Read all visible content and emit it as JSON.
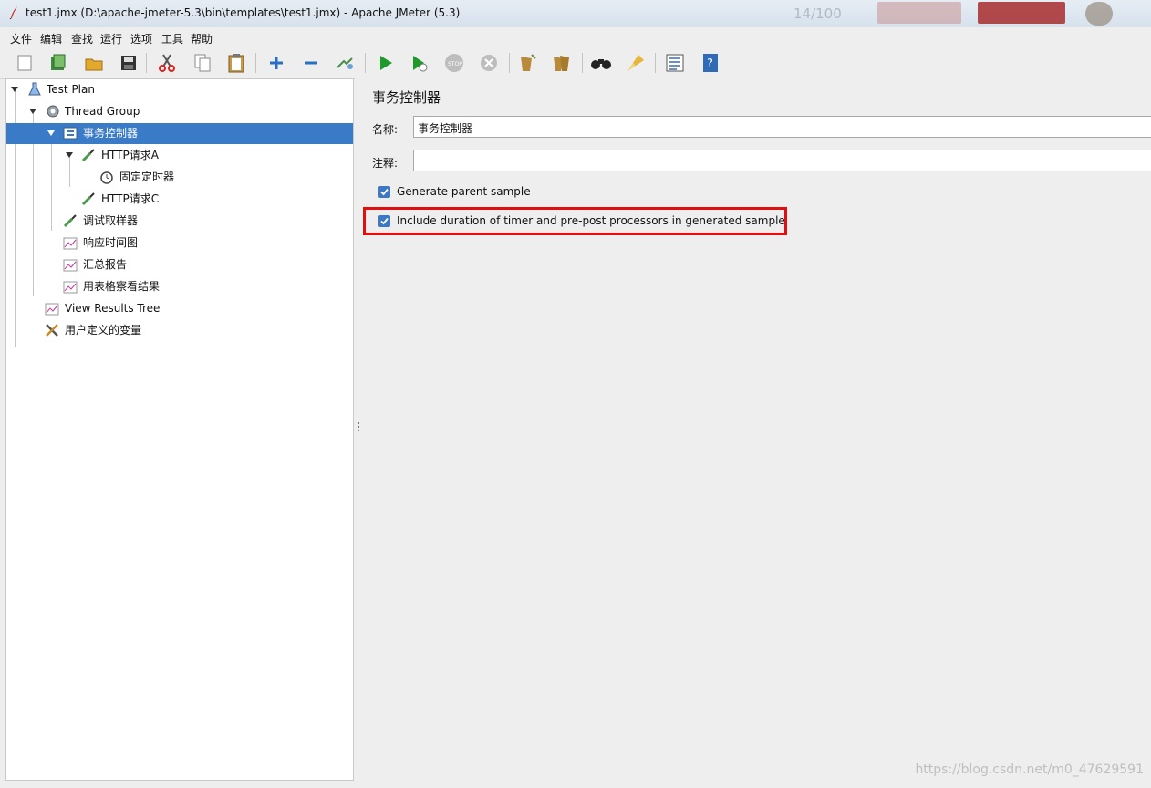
{
  "window": {
    "title": "test1.jmx (D:\\apache-jmeter-5.3\\bin\\templates\\test1.jmx) - Apache JMeter (5.3)"
  },
  "menu": [
    "文件",
    "编辑",
    "查找",
    "运行",
    "选项",
    "工具",
    "帮助"
  ],
  "toolbar": {
    "icons": [
      "new-icon",
      "templates-icon",
      "open-icon",
      "save-icon",
      "cut-icon",
      "copy-icon",
      "paste-icon",
      "add-icon",
      "remove-icon",
      "toggle-icon",
      "start-icon",
      "start-no-pauses-icon",
      "stop-icon",
      "shutdown-icon",
      "clear-icon",
      "clear-all-icon",
      "search-icon",
      "reset-search-icon",
      "function-helper-icon",
      "help-icon"
    ]
  },
  "tree": {
    "items": [
      {
        "label": "Test Plan",
        "icon": "flask-icon"
      },
      {
        "label": "Thread Group",
        "icon": "gear-icon"
      },
      {
        "label": "事务控制器",
        "icon": "controller-icon"
      },
      {
        "label": "HTTP请求A",
        "icon": "pipette-icon"
      },
      {
        "label": "固定定时器",
        "icon": "timer-icon"
      },
      {
        "label": "HTTP请求C",
        "icon": "pipette-icon"
      },
      {
        "label": "调试取样器",
        "icon": "pipette-icon"
      },
      {
        "label": "响应时间图",
        "icon": "graph-icon"
      },
      {
        "label": "汇总报告",
        "icon": "graph-icon"
      },
      {
        "label": "用表格察看结果",
        "icon": "graph-icon"
      },
      {
        "label": "View Results Tree",
        "icon": "graph-icon"
      },
      {
        "label": "用户定义的变量",
        "icon": "tools-icon"
      }
    ]
  },
  "panel": {
    "title": "事务控制器",
    "name_label": "名称:",
    "name_value": "事务控制器",
    "comment_label": "注释:",
    "comment_value": "",
    "checkbox_generate": "Generate parent sample",
    "checkbox_include": "Include duration of timer and pre-post processors in generated sample",
    "generate_checked": true,
    "include_checked": true
  },
  "watermark": "https://blog.csdn.net/m0_47629591",
  "titlebar_extra": "14/100",
  "colors": {
    "selection": "#3a7bc8",
    "highlight_box": "#e01010",
    "checkbox": "#3c78c4"
  }
}
